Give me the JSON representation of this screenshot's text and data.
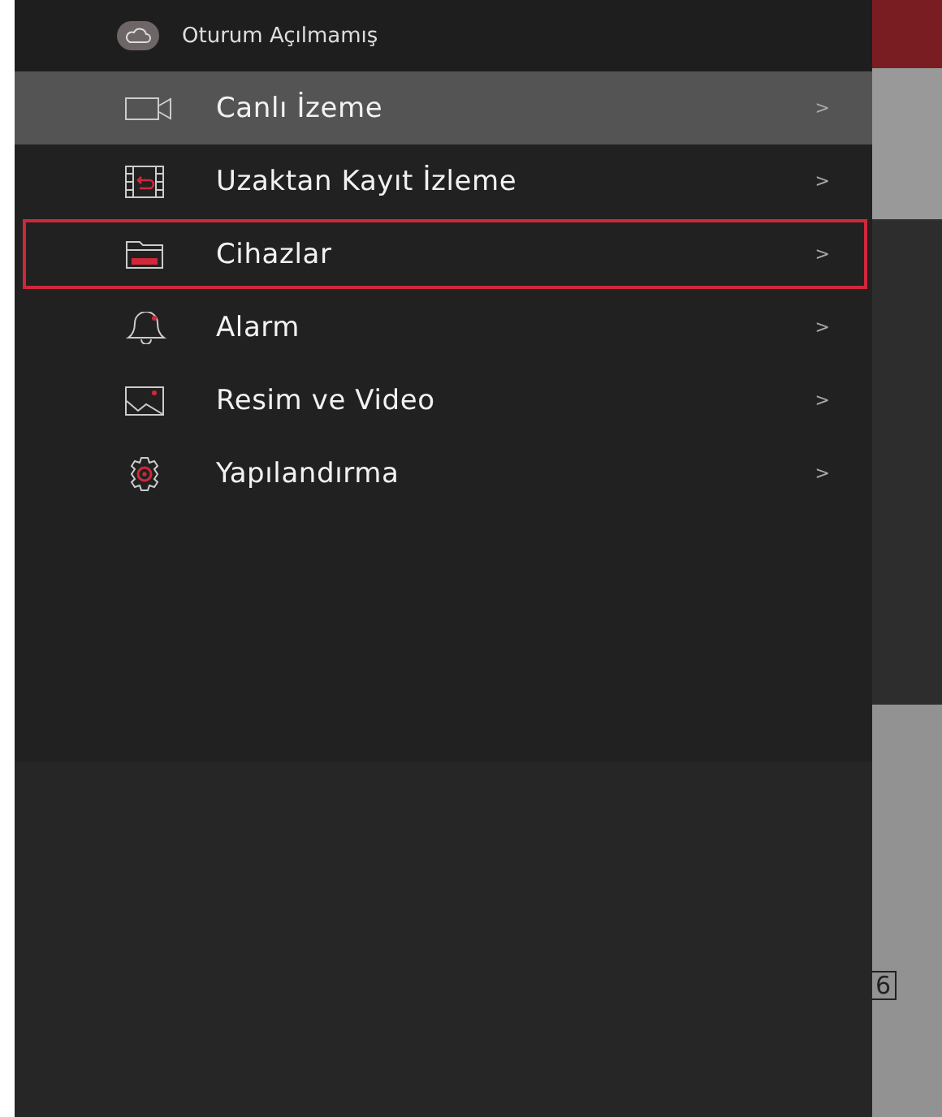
{
  "drawer": {
    "account": {
      "label": "Oturum Açılmamış"
    },
    "menu": [
      {
        "kind": "camera",
        "label": "Canlı İzeme",
        "arrow": ">",
        "selected": true,
        "outlined": false
      },
      {
        "kind": "playback",
        "label": "Uzaktan Kayıt İzleme",
        "arrow": ">",
        "selected": false,
        "outlined": false
      },
      {
        "kind": "folder",
        "label": "Cihazlar",
        "arrow": ">",
        "selected": false,
        "outlined": true
      },
      {
        "kind": "bell",
        "label": "Alarm",
        "arrow": ">",
        "selected": false,
        "outlined": false
      },
      {
        "kind": "image",
        "label": "Resim ve Video",
        "arrow": ">",
        "selected": false,
        "outlined": false
      },
      {
        "kind": "gear",
        "label": "Yapılandırma",
        "arrow": ">",
        "selected": false,
        "outlined": false
      }
    ]
  },
  "background": {
    "layout_label": "6"
  }
}
